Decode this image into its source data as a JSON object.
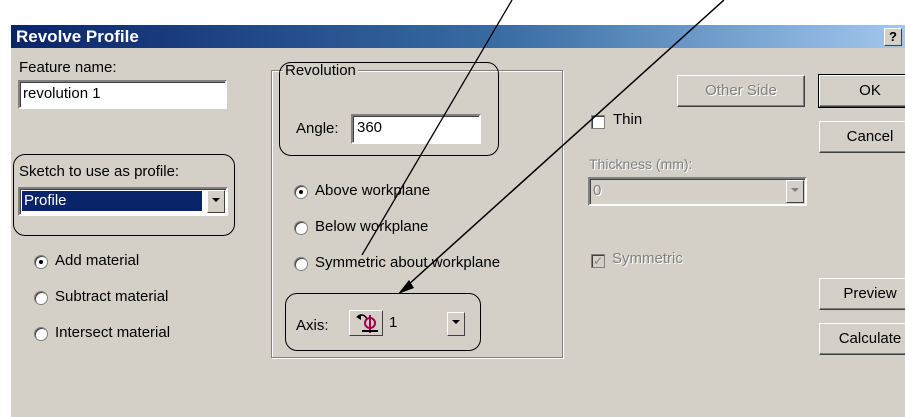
{
  "window": {
    "title": "Revolve Profile",
    "help_label": "?"
  },
  "feature": {
    "label": "Feature name:",
    "value": "revolution 1"
  },
  "sketch": {
    "label": "Sketch to use as profile:",
    "selected": "Profile"
  },
  "material_options": [
    {
      "label": "Add material",
      "selected": true
    },
    {
      "label": "Subtract material",
      "selected": false
    },
    {
      "label": "Intersect material",
      "selected": false
    }
  ],
  "revolution": {
    "group_label": "Revolution",
    "angle_label": "Angle:",
    "angle_value": "360",
    "options": [
      {
        "label": "Above workplane",
        "selected": true
      },
      {
        "label": "Below workplane",
        "selected": false
      },
      {
        "label": "Symmetric about workplane",
        "selected": false
      }
    ],
    "axis_label": "Axis:",
    "axis_value": "1"
  },
  "thin": {
    "other_side_label": "Other Side",
    "thin_label": "Thin",
    "thin_checked": false,
    "thickness_label": "Thickness (mm):",
    "thickness_value": "0",
    "symmetric_label": "Symmetric",
    "symmetric_checked": true
  },
  "buttons": {
    "ok": "OK",
    "cancel": "Cancel",
    "preview": "Preview",
    "calculate": "Calculate"
  }
}
